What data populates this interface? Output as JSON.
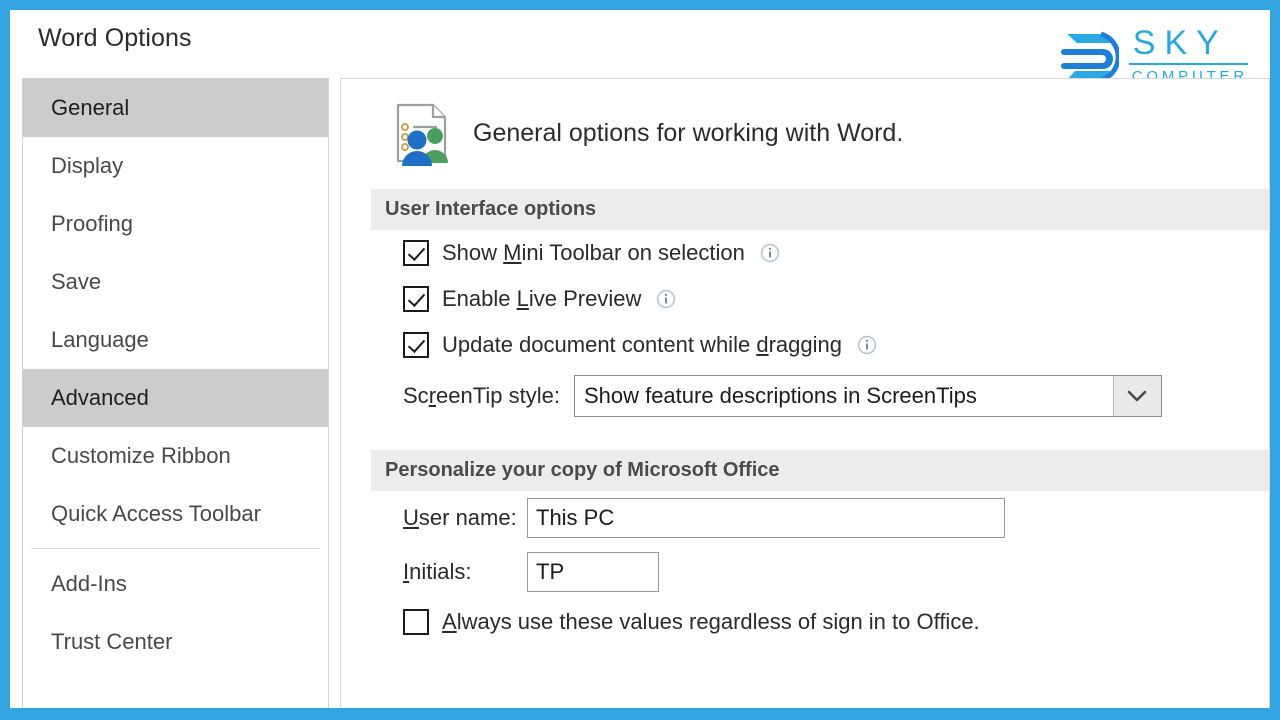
{
  "window": {
    "title": "Word Options",
    "border_color": "#34a5e0"
  },
  "brand": {
    "mark_icon": "sky-logo-mark-icon",
    "name": "SKY",
    "tagline": "COMPUTER",
    "color": "#29a8e0"
  },
  "sidebar": {
    "items": [
      {
        "label": "General",
        "selected": true
      },
      {
        "label": "Display",
        "selected": false
      },
      {
        "label": "Proofing",
        "selected": false
      },
      {
        "label": "Save",
        "selected": false
      },
      {
        "label": "Language",
        "selected": false
      },
      {
        "label": "Advanced",
        "selected": true
      },
      {
        "label": "Customize Ribbon",
        "selected": false
      },
      {
        "label": "Quick Access Toolbar",
        "selected": false
      },
      {
        "label": "Add-Ins",
        "selected": false
      },
      {
        "label": "Trust Center",
        "selected": false
      }
    ]
  },
  "content": {
    "intro": {
      "icon": "general-options-document-people-icon",
      "text": "General options for working with Word."
    },
    "ui_section": {
      "header": "User Interface options",
      "checkboxes": [
        {
          "pre": "Show ",
          "accel": "M",
          "post": "ini Toolbar on selection",
          "checked": true,
          "info": "info-icon"
        },
        {
          "pre": "Enable ",
          "accel": "L",
          "post": "ive Preview",
          "checked": true,
          "info": "info-icon"
        },
        {
          "pre": "Update document content while ",
          "accel": "d",
          "post": "ragging",
          "checked": true,
          "info": "info-icon"
        }
      ],
      "screentip": {
        "label_pre": "Sc",
        "label_accel": "r",
        "label_post": "eenTip style:",
        "value": "Show feature descriptions in ScreenTips",
        "arrow_icon": "chevron-down-icon"
      }
    },
    "personalize_section": {
      "header": "Personalize your copy of Microsoft Office",
      "fields": [
        {
          "label_pre": "",
          "label_accel": "U",
          "label_post": "ser name:",
          "value": "This PC"
        },
        {
          "label_pre": "",
          "label_accel": "I",
          "label_post": "nitials:",
          "value": "TP"
        }
      ],
      "checkbox": {
        "pre": "",
        "accel": "A",
        "post": "lways use these values regardless of sign in to Office.",
        "checked": false
      }
    }
  }
}
